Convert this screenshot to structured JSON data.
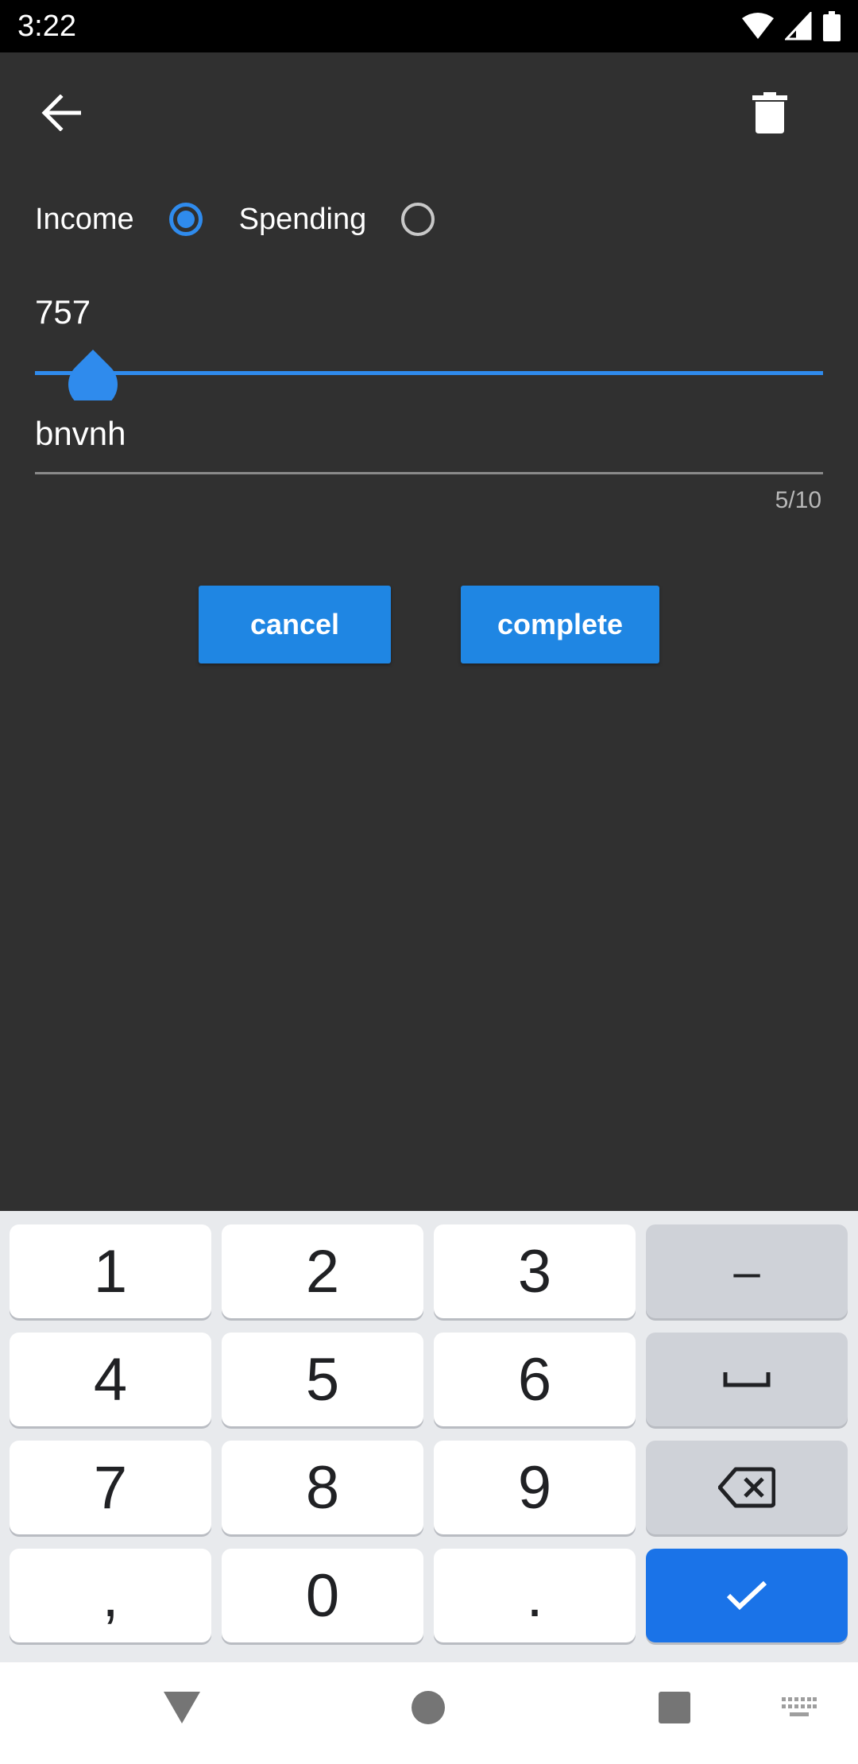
{
  "status_bar": {
    "time": "3:22"
  },
  "toolbar": {
    "back_icon": "arrow-left-icon",
    "delete_icon": "trash-icon"
  },
  "type_selector": {
    "options": [
      {
        "label": "Income",
        "checked": true
      },
      {
        "label": "Spending",
        "checked": false
      }
    ]
  },
  "amount": {
    "value": "757",
    "slider_position": 0.074
  },
  "note": {
    "value": "bnvnh",
    "counter": "5/10"
  },
  "actions": {
    "cancel_label": "cancel",
    "complete_label": "complete"
  },
  "keyboard": {
    "keys": [
      "1",
      "2",
      "3",
      "–",
      "4",
      "5",
      "6",
      "␣",
      "7",
      "8",
      "9",
      "⌫",
      ",",
      "0",
      ".",
      "✓"
    ]
  },
  "colors": {
    "accent": "#2f8bed",
    "button": "#1f86e3",
    "background": "#303030",
    "enter_key": "#1a73e8"
  }
}
